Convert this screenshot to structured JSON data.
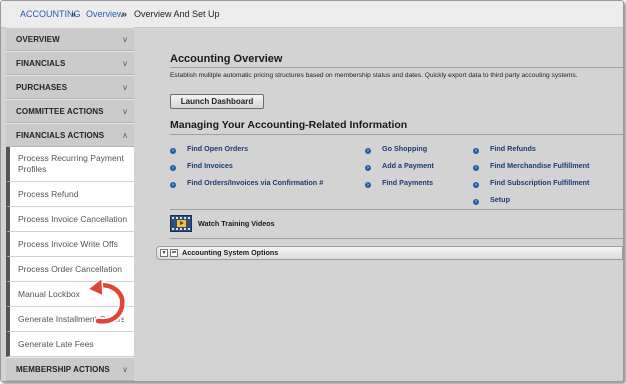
{
  "breadcrumb": {
    "root": "ACCOUNTING",
    "separator1": "»",
    "middle": "Overview",
    "separator2": "»",
    "current": "Overview And Set Up"
  },
  "sidebar": {
    "sections": {
      "overview": "OVERVIEW",
      "financials": "FINANCIALS",
      "purchases": "PURCHASES",
      "committee_actions": "COMMITTEE ACTIONS",
      "financials_actions": "FINANCIALS ACTIONS",
      "membership_actions": "MEMBERSHIP ACTIONS"
    },
    "chevron_collapsed": "∨",
    "chevron_expanded": "∧",
    "items": [
      "Process Recurring Payment Profiles",
      "Process Refund",
      "Process Invoice Cancellation",
      "Process Invoice Write Offs",
      "Process Order Cancellation",
      "Manual Lockbox",
      "Generate Installment Orders",
      "Generate Late Fees"
    ]
  },
  "main": {
    "overview_title": "Accounting Overview",
    "overview_desc": "Establish mulitple automatic pricing structures based on membership status and dates. Quickly export data to third party accouting systems.",
    "launch_button": "Launch Dashboard",
    "managing_title": "Managing Your Accounting-Related Information",
    "links_col1": [
      "Find Open Orders",
      "Find Invoices",
      "Find Orders/Invoices via Confirmation #"
    ],
    "links_col2": [
      "Go Shopping",
      "Add a Payment",
      "Find Payments"
    ],
    "links_col3": [
      "Find Refunds",
      "Find Merchandise Fulfillment",
      "Find Subscription Fulfillment",
      "Setup"
    ],
    "bullet_glyph": "›",
    "video_label": "Watch Training Videos",
    "options_label": "Accounting System Options",
    "options_toggle": "▼"
  },
  "colors": {
    "link_blue": "#2a5db0",
    "bullet_blue": "#1f5fa8",
    "arrow_red": "#e0453a",
    "sidebar_accent": "#555555"
  },
  "icons": {
    "breadcrumb_separator": "double-chevron-icon",
    "chevron": "chevron-down-icon",
    "bullet": "circle-arrow-icon",
    "video": "film-strip-icon",
    "callout_arrow": "curved-arrow-icon"
  }
}
